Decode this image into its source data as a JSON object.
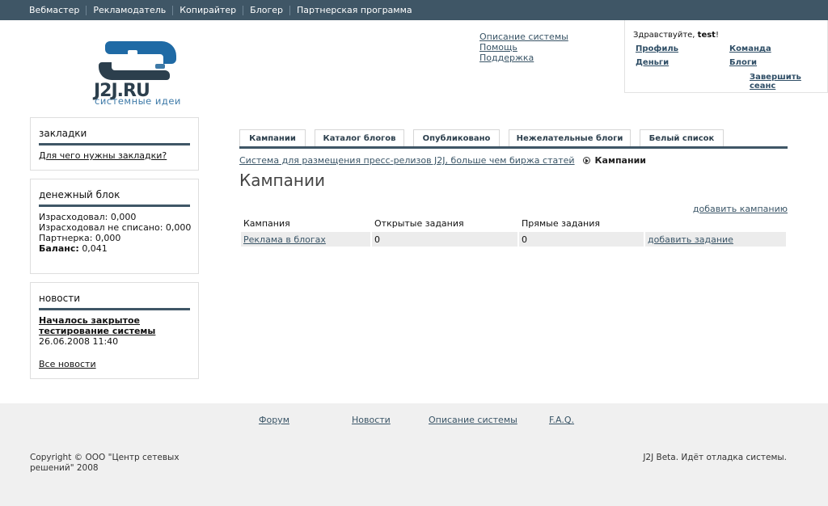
{
  "topnav": {
    "items": [
      "Вебмастер",
      "Рекламодатель",
      "Копирайтер",
      "Блогер",
      "Партнерская программа"
    ]
  },
  "logo": {
    "name": "J2J.RU",
    "tagline": "системные идеи"
  },
  "header_links": [
    "Описание системы",
    "Помощь",
    "Поддержка"
  ],
  "userbox": {
    "greeting": "Здравствуйте,",
    "username": "test",
    "links": [
      "Профиль",
      "Команда",
      "Деньги",
      "Блоги"
    ],
    "logout": "Завершить сеанс"
  },
  "bookmarks": {
    "title": "закладки",
    "link": "Для чего нужны закладки?"
  },
  "money": {
    "title": "денежный блок",
    "spent": "Израсходовал: 0,000",
    "unwritten": "Израсходовал не списано: 0,000",
    "partner": "Партнерка: 0,000",
    "balance_label": "Баланс:",
    "balance_value": "0,041"
  },
  "news": {
    "title": "новости",
    "item_title": "Началось закрытое тестирование системы",
    "item_date": "26.06.2008 11:40",
    "all_link": "Все новости"
  },
  "tabs": [
    "Кампании",
    "Каталог блогов",
    "Опубликовано",
    "Нежелательные блоги",
    "Белый список"
  ],
  "breadcrumb": {
    "root": "Система для размещения пресс-релизов J2J, больше чем биржа статей",
    "current": "Кампании"
  },
  "page_title": "Кампании",
  "add_campaign": "добавить кампанию",
  "table": {
    "headers": [
      "Кампания",
      "Открытые задания",
      "Прямые задания",
      ""
    ],
    "rows": [
      {
        "campaign": "Реклама в блогах",
        "open": "0",
        "direct": "0",
        "action": "добавить задание"
      }
    ]
  },
  "footer": {
    "links": [
      "Форум",
      "Новости",
      "Описание системы",
      "F.A.Q."
    ],
    "copyright": "Copyright © ООО \"Центр сетевых решений\" 2008",
    "status": "J2J Beta. Идёт отладка системы."
  },
  "colors": {
    "nav_bg": "#3f5666",
    "logo_dark": "#2c3f4d",
    "logo_blue": "#3e7aa8",
    "footer_bg": "#f0f0f0"
  }
}
